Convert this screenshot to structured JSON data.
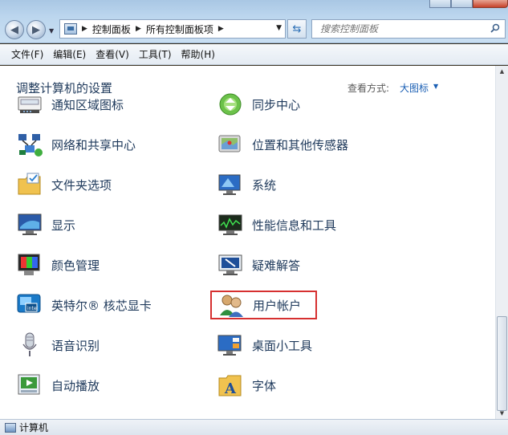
{
  "window": {
    "breadcrumbs": [
      "控制面板",
      "所有控制面板项"
    ],
    "search_placeholder": "搜索控制面板"
  },
  "menu": [
    "文件(F)",
    "编辑(E)",
    "查看(V)",
    "工具(T)",
    "帮助(H)"
  ],
  "header": {
    "title": "调整计算机的设置",
    "view_by_label": "查看方式:",
    "view_mode": "大图标"
  },
  "items": [
    {
      "label": "通知区域图标",
      "icon": "notification-area-icon"
    },
    {
      "label": "同步中心",
      "icon": "sync-center-icon"
    },
    {
      "label": "网络和共享中心",
      "icon": "network-sharing-icon"
    },
    {
      "label": "位置和其他传感器",
      "icon": "location-sensors-icon"
    },
    {
      "label": "文件夹选项",
      "icon": "folder-options-icon"
    },
    {
      "label": "系统",
      "icon": "system-icon"
    },
    {
      "label": "显示",
      "icon": "display-icon"
    },
    {
      "label": "性能信息和工具",
      "icon": "performance-icon"
    },
    {
      "label": "颜色管理",
      "icon": "color-management-icon"
    },
    {
      "label": "疑难解答",
      "icon": "troubleshooting-icon"
    },
    {
      "label": "英特尔® 核芯显卡",
      "icon": "intel-graphics-icon"
    },
    {
      "label": "用户帐户",
      "icon": "user-accounts-icon",
      "highlighted": true
    },
    {
      "label": "语音识别",
      "icon": "speech-recognition-icon"
    },
    {
      "label": "桌面小工具",
      "icon": "desktop-gadgets-icon"
    },
    {
      "label": "自动播放",
      "icon": "autoplay-icon"
    },
    {
      "label": "字体",
      "icon": "fonts-icon"
    }
  ],
  "status": {
    "text": "计算机",
    "icon": "computer-icon"
  },
  "colors": {
    "link_text": "#1e395b",
    "highlight_border": "#d63030",
    "view_mode": "#1a5fb4"
  }
}
